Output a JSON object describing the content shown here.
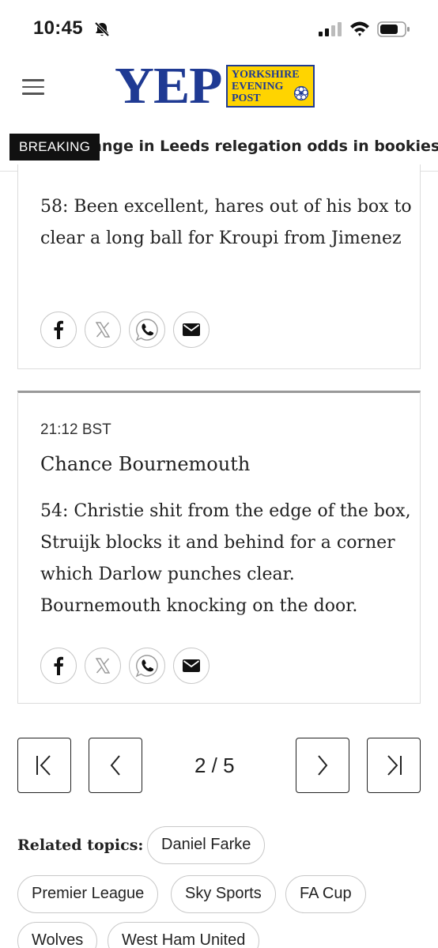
{
  "status_bar": {
    "time": "10:45",
    "icons": [
      "bell-slash-icon",
      "signal-icon",
      "wifi-icon",
      "battery-icon"
    ]
  },
  "header": {
    "logo_main": "YEP",
    "logo_box_lines": [
      "YORKSHIRE",
      "EVENING",
      "POST"
    ],
    "brand_color": "#1f3a93",
    "logo_box_color": "#ffd400"
  },
  "breaking": {
    "label": "BREAKING",
    "text": "ange in Leeds relegation odds in bookies' pre"
  },
  "posts": [
    {
      "time": "",
      "title": "",
      "body": "58: Been excellent, hares out of his box to clear a long ball for Kroupi from Jimenez",
      "share_icons": [
        "facebook-icon",
        "x-icon",
        "whatsapp-icon",
        "email-icon"
      ]
    },
    {
      "time": "21:12 BST",
      "title": "Chance Bournemouth",
      "body": "54: Christie shit from the edge of the box, Struijk blocks it and behind for a corner which Darlow punches clear. Bournemouth knocking on the door.",
      "share_icons": [
        "facebook-icon",
        "x-icon",
        "whatsapp-icon",
        "email-icon"
      ]
    }
  ],
  "pagination": {
    "indicator": "2 / 5",
    "current": 2,
    "total": 5
  },
  "related": {
    "label": "Related topics:",
    "topics": [
      "Daniel Farke",
      "Premier League",
      "Sky Sports",
      "FA Cup",
      "Wolves",
      "West Ham United"
    ]
  }
}
